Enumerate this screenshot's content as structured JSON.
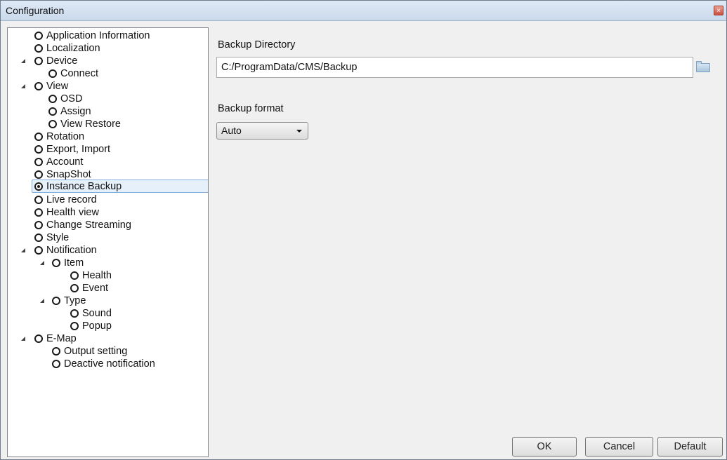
{
  "window": {
    "title": "Configuration",
    "close_glyph": "×"
  },
  "tree": {
    "items": [
      {
        "label": "Application Information",
        "expanded": null,
        "selected": false
      },
      {
        "label": "Localization",
        "expanded": null,
        "selected": false
      },
      {
        "label": "Device",
        "expanded": true,
        "selected": false
      },
      {
        "label": "Connect",
        "expanded": null,
        "selected": false
      },
      {
        "label": "View",
        "expanded": true,
        "selected": false
      },
      {
        "label": "OSD",
        "expanded": null,
        "selected": false
      },
      {
        "label": "Assign",
        "expanded": null,
        "selected": false
      },
      {
        "label": "View Restore",
        "expanded": null,
        "selected": false
      },
      {
        "label": "Rotation",
        "expanded": null,
        "selected": false
      },
      {
        "label": "Export, Import",
        "expanded": null,
        "selected": false
      },
      {
        "label": "Account",
        "expanded": null,
        "selected": false
      },
      {
        "label": "SnapShot",
        "expanded": null,
        "selected": false
      },
      {
        "label": "Instance Backup",
        "expanded": null,
        "selected": true
      },
      {
        "label": "Live record",
        "expanded": null,
        "selected": false
      },
      {
        "label": "Health view",
        "expanded": null,
        "selected": false
      },
      {
        "label": "Change Streaming",
        "expanded": null,
        "selected": false
      },
      {
        "label": "Style",
        "expanded": null,
        "selected": false
      },
      {
        "label": "Notification",
        "expanded": true,
        "selected": false
      },
      {
        "label": "Item",
        "expanded": true,
        "selected": false
      },
      {
        "label": "Health",
        "expanded": null,
        "selected": false
      },
      {
        "label": "Event",
        "expanded": null,
        "selected": false
      },
      {
        "label": "Type",
        "expanded": true,
        "selected": false
      },
      {
        "label": "Sound",
        "expanded": null,
        "selected": false
      },
      {
        "label": "Popup",
        "expanded": null,
        "selected": false
      },
      {
        "label": "E-Map",
        "expanded": true,
        "selected": false
      },
      {
        "label": "Output setting",
        "expanded": null,
        "selected": false
      },
      {
        "label": "Deactive notification",
        "expanded": null,
        "selected": false
      }
    ]
  },
  "settings": {
    "backup_directory_label": "Backup Directory",
    "backup_directory_value": "C:/ProgramData/CMS/Backup",
    "backup_format_label": "Backup format",
    "backup_format_selected": "Auto"
  },
  "buttons": {
    "ok": "OK",
    "cancel": "Cancel",
    "default": "Default"
  },
  "icons": {
    "browse": "folder-icon",
    "dropdown": "chevron-down-icon",
    "close": "close-icon"
  }
}
